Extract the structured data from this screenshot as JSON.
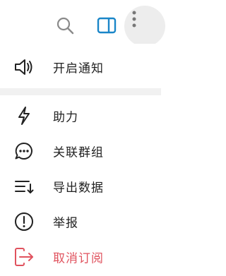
{
  "toolbar": {
    "icons": [
      "search-icon",
      "panel-icon",
      "more-vertical-icon"
    ],
    "accent": "#1a86c8"
  },
  "menu": {
    "items": [
      {
        "label": "开启通知",
        "icon": "speaker-icon"
      },
      {
        "label": "助力",
        "icon": "lightning-icon"
      },
      {
        "label": "关联群组",
        "icon": "chat-bubble-icon"
      },
      {
        "label": "导出数据",
        "icon": "export-list-icon"
      },
      {
        "label": "举报",
        "icon": "alert-circle-icon"
      },
      {
        "label": "取消订阅",
        "icon": "logout-icon"
      }
    ],
    "danger_color": "#e0525e",
    "text_color": "#222222"
  }
}
